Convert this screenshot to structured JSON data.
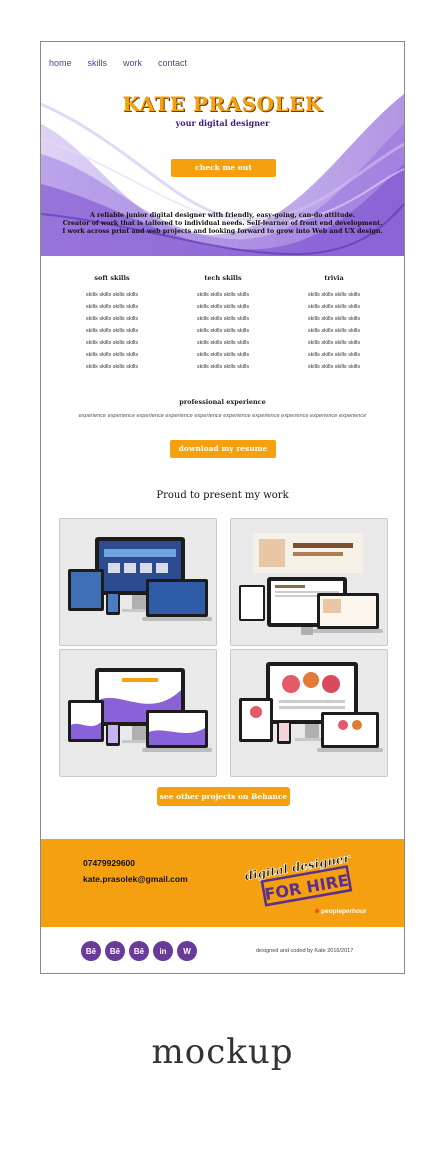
{
  "nav": {
    "items": [
      "home",
      "skills",
      "work",
      "contact"
    ]
  },
  "hero": {
    "name": "KATE PRASOLEK",
    "subtitle": "your digital designer",
    "button": "check me out",
    "lines": [
      "A reliable junior digital designer with friendly, easy-going, can-do attitude.",
      "Creator of work that is tailored to individual needs. Self-learner of front end development.",
      "I work across print and web projects and looking forward to grow into Web and UX design."
    ]
  },
  "skills": {
    "columns": [
      {
        "title": "soft skills",
        "rows": [
          "skills skills skills skills",
          "skills skills skills skills",
          "skills skills skills skills",
          "skills skills skills skills",
          "skills skills skills skills",
          "skills skills skills skills",
          "skills skills skills skills"
        ]
      },
      {
        "title": "tech skills",
        "rows": [
          "skills skills skills skills",
          "skills skills skills skills",
          "skills skills skills skills",
          "skills skills skills skills",
          "skills skills skills skills",
          "skills skills skills skills",
          "skills skills skills skills"
        ]
      },
      {
        "title": "trivia",
        "rows": [
          "skills skills skills skills",
          "skills skills skills skills",
          "skills skills skills skills",
          "skills skills skills skills",
          "skills skills skills skills",
          "skills skills skills skills",
          "skills skills skills skills"
        ]
      }
    ]
  },
  "experience": {
    "title": "professional experience",
    "text": "experience experience experience experience experience experience experience experience experience experience"
  },
  "resume_button": "download my resume",
  "work": {
    "title": "Proud to present my work",
    "behance_button": "see other projects on Behance"
  },
  "footer": {
    "phone": "07479929600",
    "email": "kate.prasolek@gmail.com",
    "hire_line1": "digital designer",
    "hire_line2": "FOR HIRE",
    "hire_brand": "peopleperhour",
    "social": [
      "Bē",
      "Bē",
      "Bē",
      "in",
      "W"
    ],
    "credit": "designed and coded by Kate 2016/2017"
  },
  "caption": "mockup",
  "colors": {
    "accent": "#f5a00f",
    "purple": "#6a3a9a"
  }
}
